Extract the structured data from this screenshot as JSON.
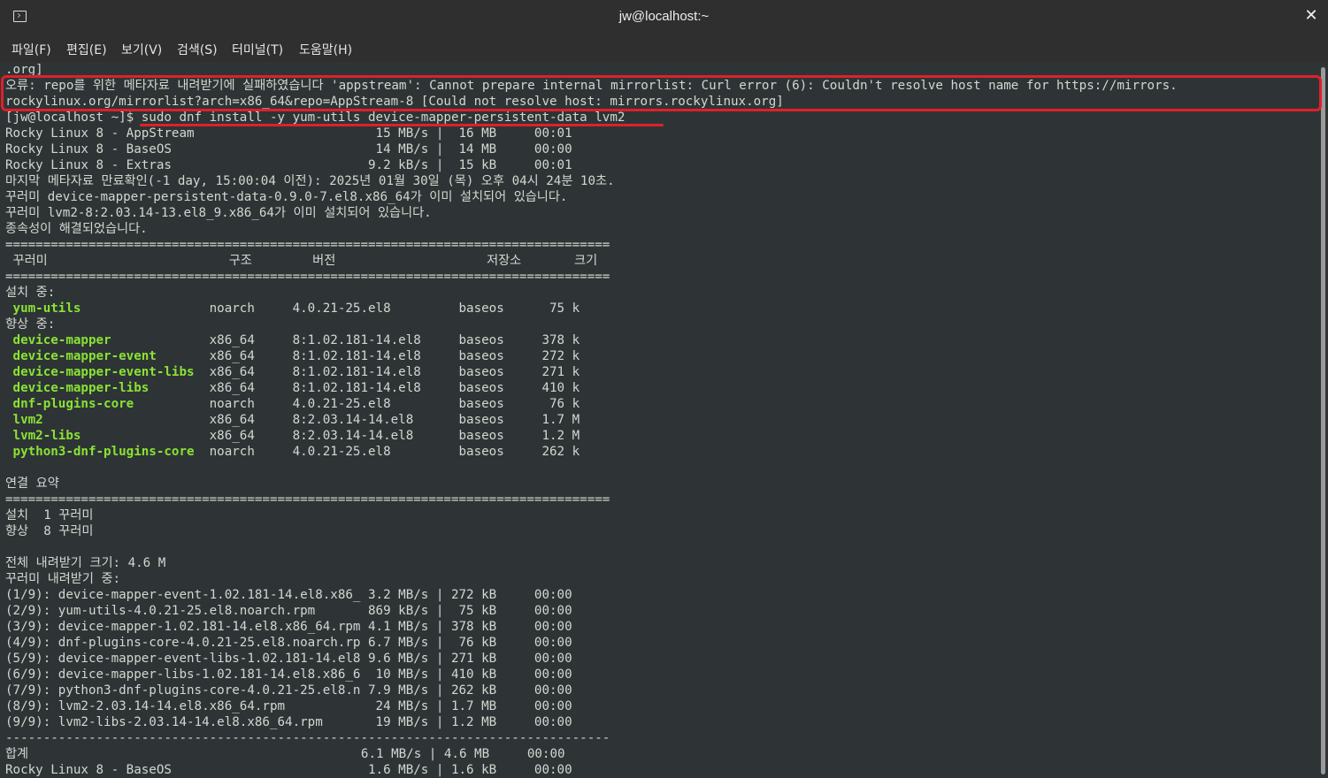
{
  "window": {
    "title": "jw@localhost:~",
    "terminal_icon": "terminal-icon",
    "close_glyph": "✕",
    "annotation_color": "#e0202a",
    "package_color": "#8ae234"
  },
  "menu": {
    "items": [
      {
        "label": "파일(F)"
      },
      {
        "label": "편집(E)"
      },
      {
        "label": "보기(V)"
      },
      {
        "label": "검색(S)"
      },
      {
        "label": "터미널(T)"
      },
      {
        "label": "도움말(H)"
      }
    ]
  },
  "terminal": {
    "lines": [
      {
        "text": ".org]"
      },
      {
        "text": "오류: repo를 위한 메타자료 내려받기에 실패하였습니다 'appstream': Cannot prepare internal mirrorlist: Curl error (6): Couldn't resolve host name for https://mirrors."
      },
      {
        "text": "rockylinux.org/mirrorlist?arch=x86_64&repo=AppStream-8 [Could not resolve host: mirrors.rockylinux.org]"
      },
      {
        "text": "[jw@localhost ~]$ sudo dnf install -y yum-utils device-mapper-persistent-data lvm2"
      },
      {
        "text": "Rocky Linux 8 - AppStream                        15 MB/s |  16 MB     00:01"
      },
      {
        "text": "Rocky Linux 8 - BaseOS                           14 MB/s |  14 MB     00:00"
      },
      {
        "text": "Rocky Linux 8 - Extras                          9.2 kB/s |  15 kB     00:01"
      },
      {
        "text": "마지막 메타자료 만료확인(-1 day, 15:00:04 이전): 2025년 01월 30일 (목) 오후 04시 24분 10초."
      },
      {
        "text": "꾸러미 device-mapper-persistent-data-0.9.0-7.el8.x86_64가 이미 설치되어 있습니다."
      },
      {
        "text": "꾸러미 lvm2-8:2.03.14-13.el8_9.x86_64가 이미 설치되어 있습니다."
      },
      {
        "text": "종속성이 해결되었습니다."
      },
      {
        "text": "================================================================================"
      },
      {
        "text": " 꾸러미                        구조        버전                    저장소       크기"
      },
      {
        "text": "================================================================================"
      },
      {
        "text": "설치 중:"
      },
      {
        "pkg": "yum-utils",
        "rest": "                 noarch     4.0.21-25.el8         baseos      75 k"
      },
      {
        "text": "향상 중:"
      },
      {
        "pkg": "device-mapper",
        "rest": "             x86_64     8:1.02.181-14.el8     baseos     378 k"
      },
      {
        "pkg": "device-mapper-event",
        "rest": "       x86_64     8:1.02.181-14.el8     baseos     272 k"
      },
      {
        "pkg": "device-mapper-event-libs",
        "rest": "  x86_64     8:1.02.181-14.el8     baseos     271 k"
      },
      {
        "pkg": "device-mapper-libs",
        "rest": "        x86_64     8:1.02.181-14.el8     baseos     410 k"
      },
      {
        "pkg": "dnf-plugins-core",
        "rest": "          noarch     4.0.21-25.el8         baseos      76 k"
      },
      {
        "pkg": "lvm2",
        "rest": "                      x86_64     8:2.03.14-14.el8      baseos     1.7 M"
      },
      {
        "pkg": "lvm2-libs",
        "rest": "                 x86_64     8:2.03.14-14.el8      baseos     1.2 M"
      },
      {
        "pkg": "python3-dnf-plugins-core",
        "rest": "  noarch     4.0.21-25.el8         baseos     262 k"
      },
      {
        "text": ""
      },
      {
        "text": "연결 요약"
      },
      {
        "text": "================================================================================"
      },
      {
        "text": "설치  1 꾸러미"
      },
      {
        "text": "향상  8 꾸러미"
      },
      {
        "text": ""
      },
      {
        "text": "전체 내려받기 크기: 4.6 M"
      },
      {
        "text": "꾸러미 내려받기 중:"
      },
      {
        "text": "(1/9): device-mapper-event-1.02.181-14.el8.x86_ 3.2 MB/s | 272 kB     00:00"
      },
      {
        "text": "(2/9): yum-utils-4.0.21-25.el8.noarch.rpm       869 kB/s |  75 kB     00:00"
      },
      {
        "text": "(3/9): device-mapper-1.02.181-14.el8.x86_64.rpm 4.1 MB/s | 378 kB     00:00"
      },
      {
        "text": "(4/9): dnf-plugins-core-4.0.21-25.el8.noarch.rp 6.7 MB/s |  76 kB     00:00"
      },
      {
        "text": "(5/9): device-mapper-event-libs-1.02.181-14.el8 9.6 MB/s | 271 kB     00:00"
      },
      {
        "text": "(6/9): device-mapper-libs-1.02.181-14.el8.x86_6  10 MB/s | 410 kB     00:00"
      },
      {
        "text": "(7/9): python3-dnf-plugins-core-4.0.21-25.el8.n 7.9 MB/s | 262 kB     00:00"
      },
      {
        "text": "(8/9): lvm2-2.03.14-14.el8.x86_64.rpm            24 MB/s | 1.7 MB     00:00"
      },
      {
        "text": "(9/9): lvm2-libs-2.03.14-14.el8.x86_64.rpm       19 MB/s | 1.2 MB     00:00"
      },
      {
        "text": "--------------------------------------------------------------------------------"
      },
      {
        "text": "합계                                            6.1 MB/s | 4.6 MB     00:00"
      },
      {
        "text": "Rocky Linux 8 - BaseOS                          1.6 MB/s | 1.6 kB     00:00"
      }
    ]
  }
}
